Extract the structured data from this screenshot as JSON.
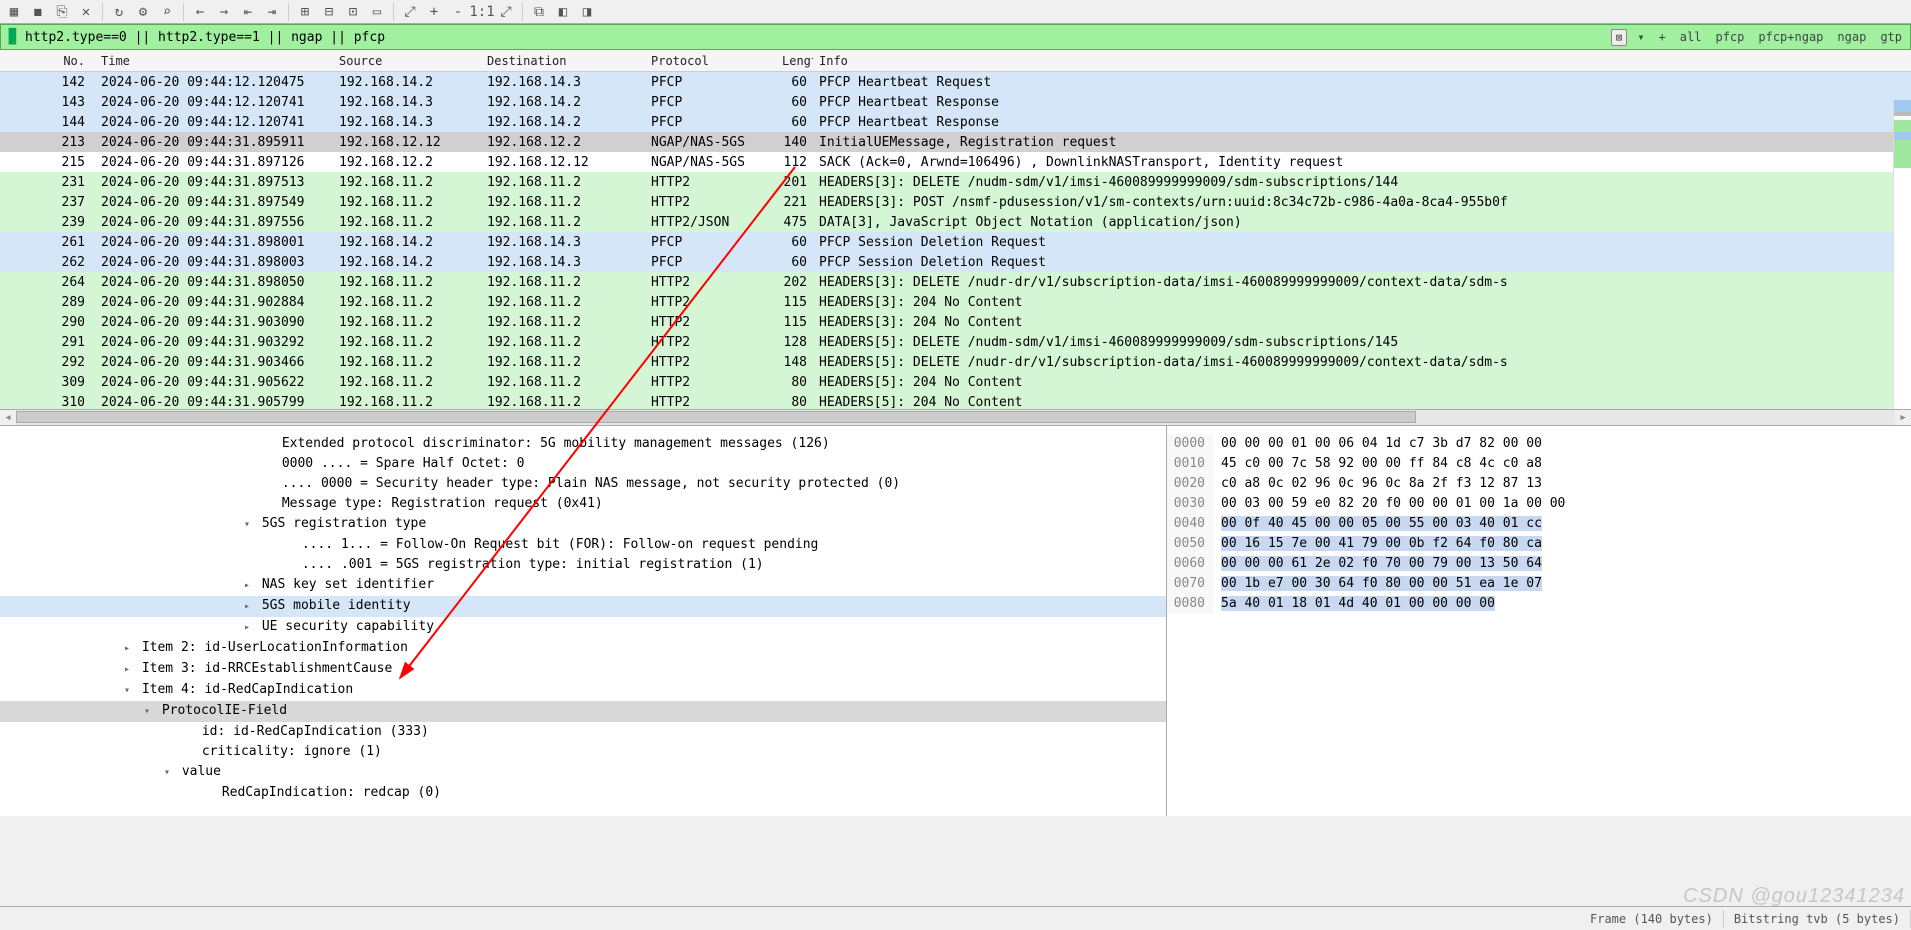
{
  "toolbar_icons": [
    "▦",
    "◼",
    "⎘",
    "✕",
    "↻",
    "⚙",
    "⌕",
    "←",
    "→",
    "⇤",
    "⇥",
    "⊞",
    "⊟",
    "⊡",
    "▭",
    "⤢",
    "+",
    "-",
    "1:1",
    "⤢",
    "⧉",
    "◧",
    "◨"
  ],
  "filter": {
    "value": "http2.type==0 || http2.type==1 || ngap || pfcp",
    "close": "⊠",
    "arrow": "▾",
    "plus": "+",
    "buttons": [
      "all",
      "pfcp",
      "pfcp+ngap",
      "ngap",
      "gtp"
    ]
  },
  "columns": [
    "No.",
    "Time",
    "Source",
    "Destination",
    "Protocol",
    "Lengt",
    "Info"
  ],
  "rows": [
    {
      "no": "142",
      "time": "2024-06-20 09:44:12.120475",
      "src": "192.168.14.2",
      "dst": "192.168.14.3",
      "proto": "PFCP",
      "len": "60",
      "info": "PFCP Heartbeat Request",
      "cls": "r-blue"
    },
    {
      "no": "143",
      "time": "2024-06-20 09:44:12.120741",
      "src": "192.168.14.3",
      "dst": "192.168.14.2",
      "proto": "PFCP",
      "len": "60",
      "info": "PFCP Heartbeat Response",
      "cls": "r-blue"
    },
    {
      "no": "144",
      "time": "2024-06-20 09:44:12.120741",
      "src": "192.168.14.3",
      "dst": "192.168.14.2",
      "proto": "PFCP",
      "len": "60",
      "info": "PFCP Heartbeat Response",
      "cls": "r-blue"
    },
    {
      "no": "213",
      "time": "2024-06-20 09:44:31.895911",
      "src": "192.168.12.12",
      "dst": "192.168.12.2",
      "proto": "NGAP/NAS-5GS",
      "len": "140",
      "info": "InitialUEMessage, Registration request",
      "cls": "r-grey"
    },
    {
      "no": "215",
      "time": "2024-06-20 09:44:31.897126",
      "src": "192.168.12.2",
      "dst": "192.168.12.12",
      "proto": "NGAP/NAS-5GS",
      "len": "112",
      "info": "SACK (Ack=0, Arwnd=106496) , DownlinkNASTransport, Identity request",
      "cls": "r-white"
    },
    {
      "no": "231",
      "time": "2024-06-20 09:44:31.897513",
      "src": "192.168.11.2",
      "dst": "192.168.11.2",
      "proto": "HTTP2",
      "len": "201",
      "info": "HEADERS[3]: DELETE /nudm-sdm/v1/imsi-460089999999009/sdm-subscriptions/144",
      "cls": "r-green"
    },
    {
      "no": "237",
      "time": "2024-06-20 09:44:31.897549",
      "src": "192.168.11.2",
      "dst": "192.168.11.2",
      "proto": "HTTP2",
      "len": "221",
      "info": "HEADERS[3]: POST /nsmf-pdusession/v1/sm-contexts/urn:uuid:8c34c72b-c986-4a0a-8ca4-955b0f",
      "cls": "r-green"
    },
    {
      "no": "239",
      "time": "2024-06-20 09:44:31.897556",
      "src": "192.168.11.2",
      "dst": "192.168.11.2",
      "proto": "HTTP2/JSON",
      "len": "475",
      "info": "DATA[3], JavaScript Object Notation (application/json)",
      "cls": "r-green"
    },
    {
      "no": "261",
      "time": "2024-06-20 09:44:31.898001",
      "src": "192.168.14.2",
      "dst": "192.168.14.3",
      "proto": "PFCP",
      "len": "60",
      "info": "PFCP Session Deletion Request",
      "cls": "r-blue"
    },
    {
      "no": "262",
      "time": "2024-06-20 09:44:31.898003",
      "src": "192.168.14.2",
      "dst": "192.168.14.3",
      "proto": "PFCP",
      "len": "60",
      "info": "PFCP Session Deletion Request",
      "cls": "r-blue"
    },
    {
      "no": "264",
      "time": "2024-06-20 09:44:31.898050",
      "src": "192.168.11.2",
      "dst": "192.168.11.2",
      "proto": "HTTP2",
      "len": "202",
      "info": "HEADERS[3]: DELETE /nudr-dr/v1/subscription-data/imsi-460089999999009/context-data/sdm-s",
      "cls": "r-green"
    },
    {
      "no": "289",
      "time": "2024-06-20 09:44:31.902884",
      "src": "192.168.11.2",
      "dst": "192.168.11.2",
      "proto": "HTTP2",
      "len": "115",
      "info": "HEADERS[3]: 204 No Content",
      "cls": "r-green"
    },
    {
      "no": "290",
      "time": "2024-06-20 09:44:31.903090",
      "src": "192.168.11.2",
      "dst": "192.168.11.2",
      "proto": "HTTP2",
      "len": "115",
      "info": "HEADERS[3]: 204 No Content",
      "cls": "r-green"
    },
    {
      "no": "291",
      "time": "2024-06-20 09:44:31.903292",
      "src": "192.168.11.2",
      "dst": "192.168.11.2",
      "proto": "HTTP2",
      "len": "128",
      "info": "HEADERS[5]: DELETE /nudm-sdm/v1/imsi-460089999999009/sdm-subscriptions/145",
      "cls": "r-green"
    },
    {
      "no": "292",
      "time": "2024-06-20 09:44:31.903466",
      "src": "192.168.11.2",
      "dst": "192.168.11.2",
      "proto": "HTTP2",
      "len": "148",
      "info": "HEADERS[5]: DELETE /nudr-dr/v1/subscription-data/imsi-460089999999009/context-data/sdm-s",
      "cls": "r-green"
    },
    {
      "no": "309",
      "time": "2024-06-20 09:44:31.905622",
      "src": "192.168.11.2",
      "dst": "192.168.11.2",
      "proto": "HTTP2",
      "len": "80",
      "info": "HEADERS[5]: 204 No Content",
      "cls": "r-green"
    },
    {
      "no": "310",
      "time": "2024-06-20 09:44:31.905799",
      "src": "192.168.11.2",
      "dst": "192.168.11.2",
      "proto": "HTTP2",
      "len": "80",
      "info": "HEADERS[5]: 204 No Content",
      "cls": "r-green"
    }
  ],
  "detail": [
    {
      "indent": 12,
      "exp": "",
      "text": "Extended protocol discriminator: 5G mobility management messages (126)"
    },
    {
      "indent": 12,
      "exp": "",
      "text": "0000 .... = Spare Half Octet: 0"
    },
    {
      "indent": 12,
      "exp": "",
      "text": ".... 0000 = Security header type: Plain NAS message, not security protected (0)"
    },
    {
      "indent": 12,
      "exp": "",
      "text": "Message type: Registration request (0x41)"
    },
    {
      "indent": 11,
      "exp": "v",
      "text": "5GS registration type"
    },
    {
      "indent": 13,
      "exp": "",
      "text": ".... 1... = Follow-On Request bit (FOR): Follow-on request pending"
    },
    {
      "indent": 13,
      "exp": "",
      "text": ".... .001 = 5GS registration type: initial registration (1)"
    },
    {
      "indent": 11,
      "exp": ">",
      "text": "NAS key set identifier"
    },
    {
      "indent": 11,
      "exp": ">",
      "text": "5GS mobile identity",
      "cls": "sel"
    },
    {
      "indent": 11,
      "exp": ">",
      "text": "UE security capability"
    },
    {
      "indent": 5,
      "exp": ">",
      "text": "Item 2: id-UserLocationInformation"
    },
    {
      "indent": 5,
      "exp": ">",
      "text": "Item 3: id-RRCEstablishmentCause"
    },
    {
      "indent": 5,
      "exp": "v",
      "text": "Item 4: id-RedCapIndication"
    },
    {
      "indent": 6,
      "exp": "v",
      "text": "ProtocolIE-Field",
      "cls": "hl"
    },
    {
      "indent": 8,
      "exp": "",
      "text": "id: id-RedCapIndication (333)"
    },
    {
      "indent": 8,
      "exp": "",
      "text": "criticality: ignore (1)"
    },
    {
      "indent": 7,
      "exp": "v",
      "text": "value"
    },
    {
      "indent": 9,
      "exp": "",
      "text": "RedCapIndication: redcap (0)"
    }
  ],
  "hex": [
    {
      "off": "0000",
      "b": "00 00 00 01 00 06 04 1d   c7 3b d7 82 00 00"
    },
    {
      "off": "0010",
      "b": "45 c0 00 7c 58 92 00 00   ff 84 c8 4c c0 a8"
    },
    {
      "off": "0020",
      "b": "c0 a8 0c 02 96 0c 96 0c   8a 2f f3 12 87 13"
    },
    {
      "off": "0030",
      "b": "00 03 00 59 e0 82 20 f0   00 00 01 00 1a 00 00"
    },
    {
      "off": "0040",
      "b": "<b>00 0f 40 45 00 00 05 00   55 00 03 40 01 cc</b>"
    },
    {
      "off": "0050",
      "b": "<b>00 16 15 7e 00 41 79 00   0b f2 64 f0 80 ca</b>"
    },
    {
      "off": "0060",
      "b": "<b>00 00 00 61 2e 02 f0 70   00 79 00 13 50 64</b>"
    },
    {
      "off": "0070",
      "b": "<b>00 1b e7 00 30 64 f0 80   00 00 51 ea 1e 07</b>"
    },
    {
      "off": "0080",
      "b": "<b>5a 40 01 18 01 4d 40 01   00 00 00 00</b>"
    }
  ],
  "status": {
    "frame": "Frame (140 bytes)",
    "bitstring": "Bitstring tvb (5 bytes)"
  },
  "watermark": "CSDN @gou12341234"
}
